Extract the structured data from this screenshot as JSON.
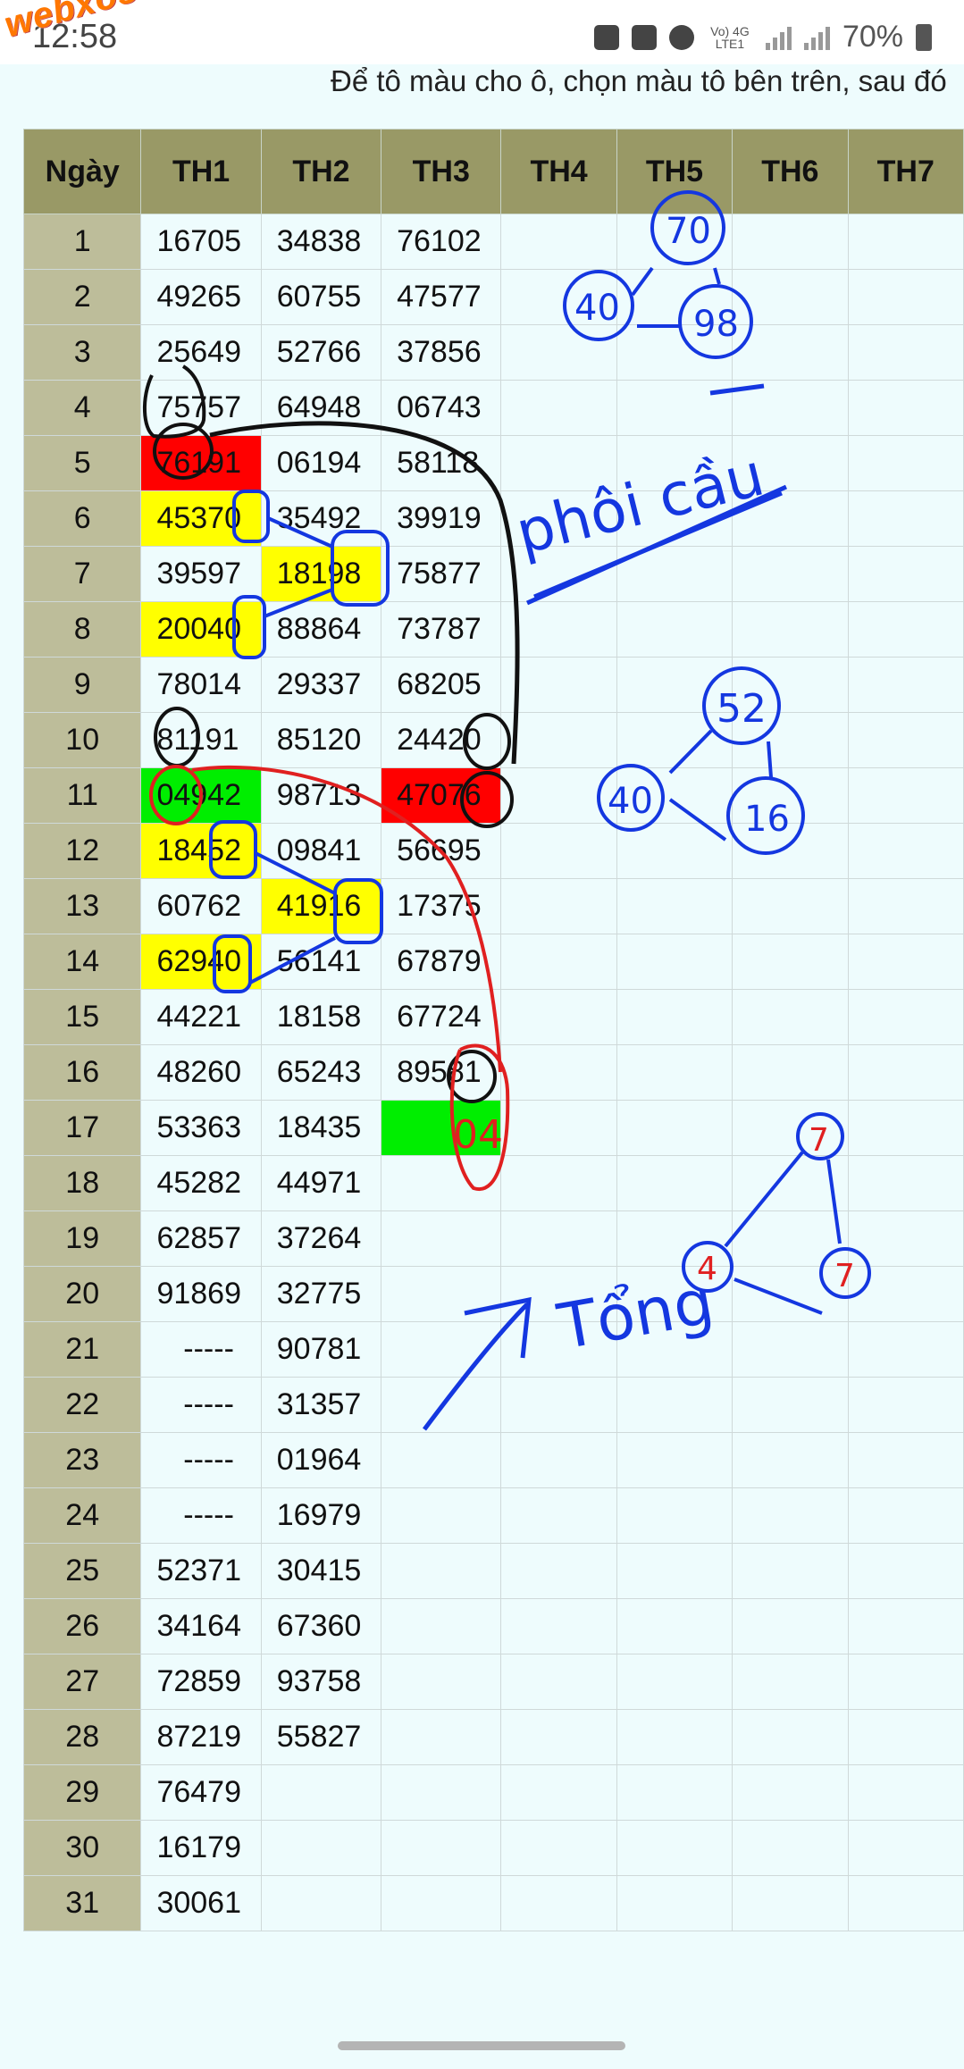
{
  "status": {
    "time": "12:58",
    "network": "Vo) 4G LTE1",
    "battery": "70%"
  },
  "watermark": "webxoso.net",
  "instruction": "Để tô màu cho ô, chọn màu tô bên trên, sau đó",
  "table": {
    "headers": [
      "Ngày",
      "TH1",
      "TH2",
      "TH3",
      "TH4",
      "TH5",
      "TH6",
      "TH7"
    ],
    "rows": [
      [
        "1",
        "16705",
        "34838",
        "76102",
        "",
        "",
        "",
        ""
      ],
      [
        "2",
        "49265",
        "60755",
        "47577",
        "",
        "",
        "",
        ""
      ],
      [
        "3",
        "25649",
        "52766",
        "37856",
        "",
        "",
        "",
        ""
      ],
      [
        "4",
        "75757",
        "64948",
        "06743",
        "",
        "",
        "",
        ""
      ],
      [
        "5",
        "76191",
        "06194",
        "58118",
        "",
        "",
        "",
        ""
      ],
      [
        "6",
        "45370",
        "35492",
        "39919",
        "",
        "",
        "",
        ""
      ],
      [
        "7",
        "39597",
        "18198",
        "75877",
        "",
        "",
        "",
        ""
      ],
      [
        "8",
        "20040",
        "88864",
        "73787",
        "",
        "",
        "",
        ""
      ],
      [
        "9",
        "78014",
        "29337",
        "68205",
        "",
        "",
        "",
        ""
      ],
      [
        "10",
        "81191",
        "85120",
        "24420",
        "",
        "",
        "",
        ""
      ],
      [
        "11",
        "04942",
        "98713",
        "47076",
        "",
        "",
        "",
        ""
      ],
      [
        "12",
        "18452",
        "09841",
        "56695",
        "",
        "",
        "",
        ""
      ],
      [
        "13",
        "60762",
        "41916",
        "17375",
        "",
        "",
        "",
        ""
      ],
      [
        "14",
        "62940",
        "56141",
        "67879",
        "",
        "",
        "",
        ""
      ],
      [
        "15",
        "44221",
        "18158",
        "67724",
        "",
        "",
        "",
        ""
      ],
      [
        "16",
        "48260",
        "65243",
        "89581",
        "",
        "",
        "",
        ""
      ],
      [
        "17",
        "53363",
        "18435",
        "",
        "",
        "",
        "",
        ""
      ],
      [
        "18",
        "45282",
        "44971",
        "",
        "",
        "",
        "",
        ""
      ],
      [
        "19",
        "62857",
        "37264",
        "",
        "",
        "",
        "",
        ""
      ],
      [
        "20",
        "91869",
        "32775",
        "",
        "",
        "",
        "",
        ""
      ],
      [
        "21",
        "-----",
        "90781",
        "",
        "",
        "",
        "",
        ""
      ],
      [
        "22",
        "-----",
        "31357",
        "",
        "",
        "",
        "",
        ""
      ],
      [
        "23",
        "-----",
        "01964",
        "",
        "",
        "",
        "",
        ""
      ],
      [
        "24",
        "-----",
        "16979",
        "",
        "",
        "",
        "",
        ""
      ],
      [
        "25",
        "52371",
        "30415",
        "",
        "",
        "",
        "",
        ""
      ],
      [
        "26",
        "34164",
        "67360",
        "",
        "",
        "",
        "",
        ""
      ],
      [
        "27",
        "72859",
        "93758",
        "",
        "",
        "",
        "",
        ""
      ],
      [
        "28",
        "87219",
        "55827",
        "",
        "",
        "",
        "",
        ""
      ],
      [
        "29",
        "76479",
        "",
        "",
        "",
        "",
        "",
        ""
      ],
      [
        "30",
        "16179",
        "",
        "",
        "",
        "",
        "",
        ""
      ],
      [
        "31",
        "30061",
        "",
        "",
        "",
        "",
        "",
        ""
      ]
    ],
    "highlights": [
      {
        "row": 5,
        "col": 1,
        "color": "#ff0000"
      },
      {
        "row": 6,
        "col": 1,
        "color": "#ffff00"
      },
      {
        "row": 7,
        "col": 2,
        "color": "#ffff00"
      },
      {
        "row": 8,
        "col": 1,
        "color": "#ffff00"
      },
      {
        "row": 11,
        "col": 1,
        "color": "#00ee00"
      },
      {
        "row": 11,
        "col": 3,
        "color": "#ff0000"
      },
      {
        "row": 12,
        "col": 1,
        "color": "#ffff00"
      },
      {
        "row": 13,
        "col": 2,
        "color": "#ffff00"
      },
      {
        "row": 14,
        "col": 1,
        "color": "#ffff00"
      },
      {
        "row": 17,
        "col": 3,
        "color": "#00ee00"
      }
    ]
  },
  "annotations": {
    "triangle1": [
      "70",
      "40",
      "98"
    ],
    "triangle2": [
      "52",
      "40",
      "16"
    ],
    "triangle3": [
      "7",
      "4",
      "7"
    ],
    "handwriting1": "phôi cầu",
    "handwriting2": "Tổng",
    "handwritten_cell": "04",
    "ink_colors": {
      "blue": "#1437e0",
      "black": "#111111",
      "red": "#e02020"
    }
  }
}
